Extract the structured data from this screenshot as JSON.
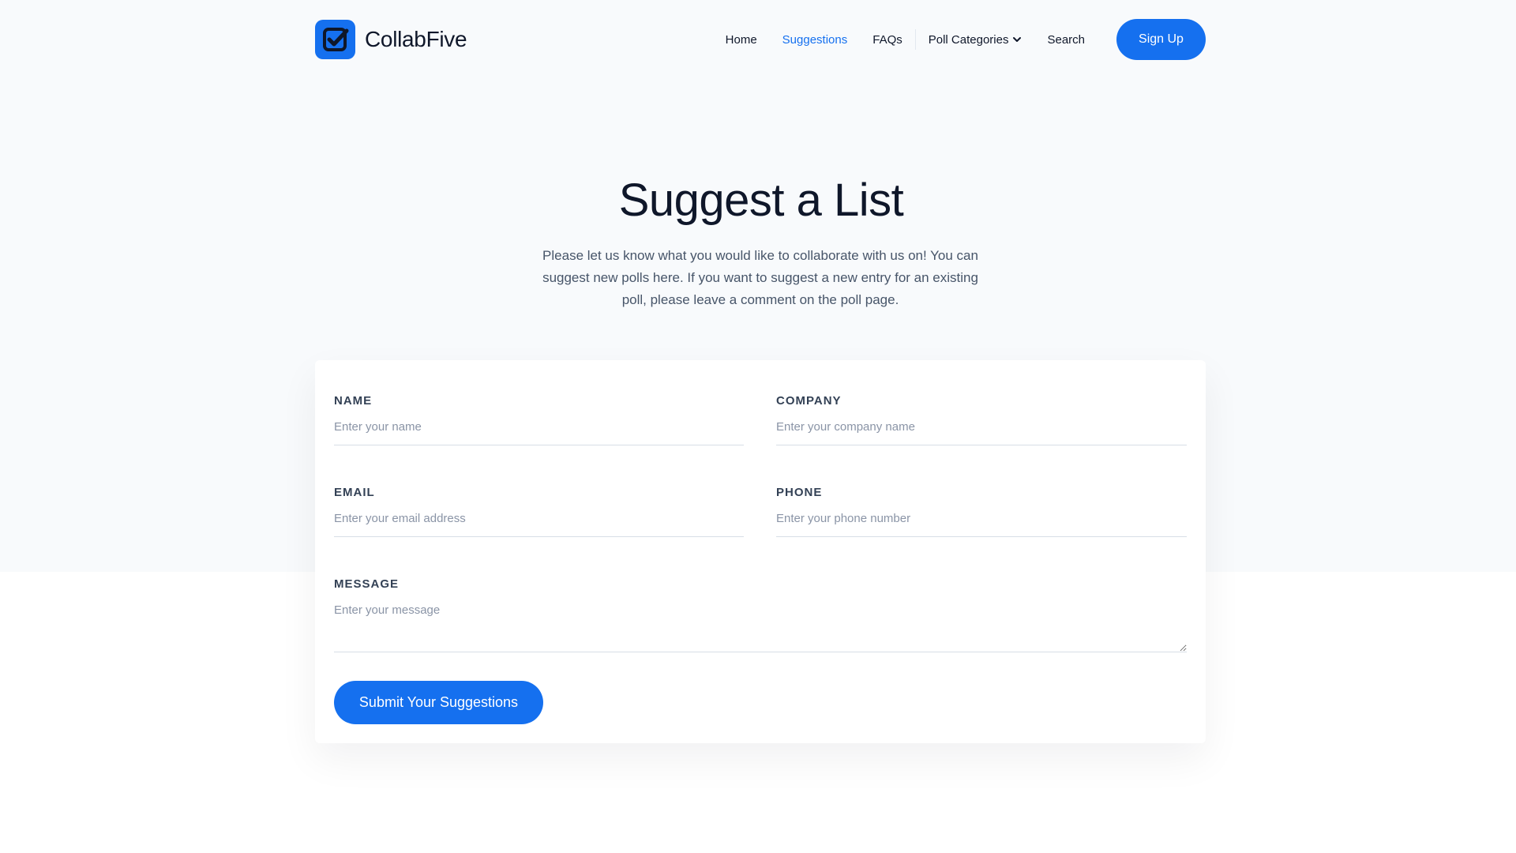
{
  "brand": {
    "name": "CollabFive",
    "logo_icon": "checkbox-check-icon",
    "accent": "#1570ef"
  },
  "nav": {
    "items": [
      {
        "label": "Home",
        "active": false
      },
      {
        "label": "Suggestions",
        "active": true
      },
      {
        "label": "FAQs",
        "active": false
      },
      {
        "label": "Poll Categories",
        "active": false,
        "icon": "chevron-down-icon"
      },
      {
        "label": "Search",
        "active": false
      }
    ],
    "signup_label": "Sign Up"
  },
  "hero": {
    "title": "Suggest a List",
    "description": "Please let us know what you would like to collaborate with us on! You can suggest new polls here. If you want to suggest a new entry for an existing poll, please leave a comment on the poll page."
  },
  "form": {
    "name": {
      "label": "NAME",
      "placeholder": "Enter your name",
      "value": ""
    },
    "company": {
      "label": "COMPANY",
      "placeholder": "Enter your company name",
      "value": ""
    },
    "email": {
      "label": "EMAIL",
      "placeholder": "Enter your email address",
      "value": ""
    },
    "phone": {
      "label": "PHONE",
      "placeholder": "Enter your phone number",
      "value": ""
    },
    "message": {
      "label": "MESSAGE",
      "placeholder": "Enter your message",
      "value": ""
    },
    "submit_label": "Submit Your Suggestions"
  }
}
